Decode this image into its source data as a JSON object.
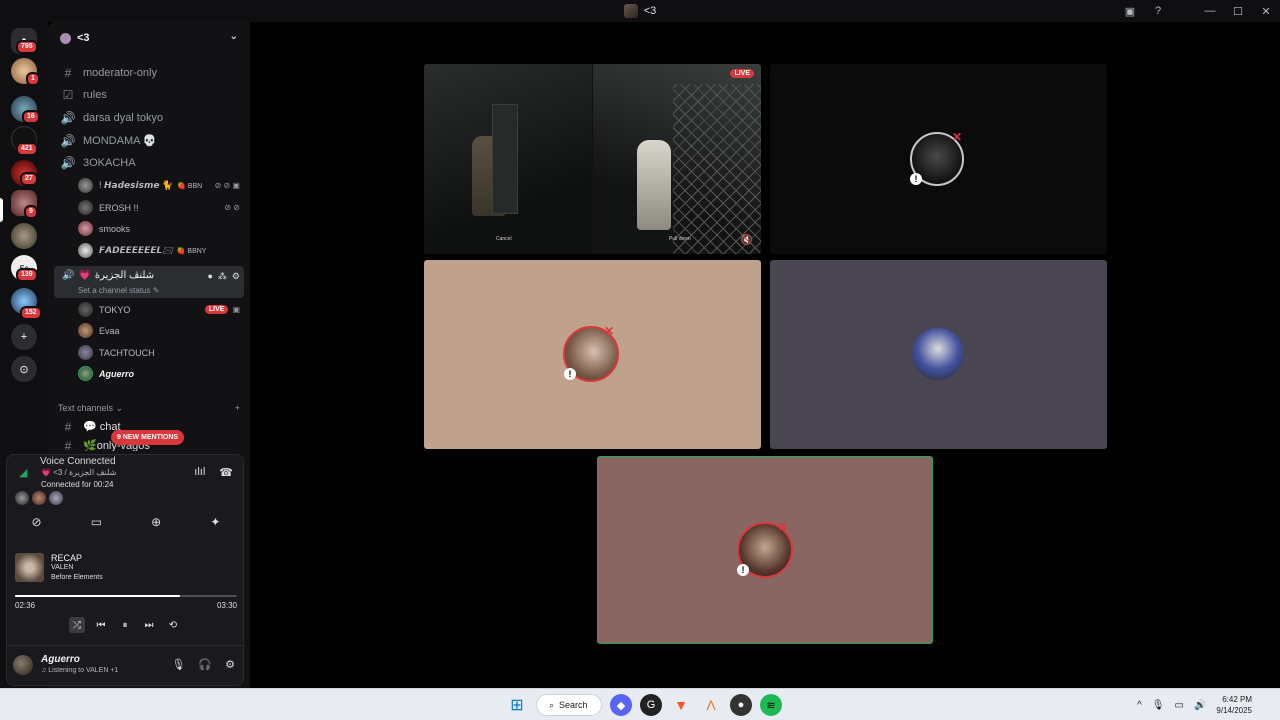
{
  "window": {
    "title": "<3",
    "controls": [
      "—",
      "☐",
      "✕"
    ]
  },
  "rail": {
    "home_badge": "795",
    "servers": [
      {
        "badge": "1"
      },
      {
        "badge": "16"
      },
      {
        "badge": "421"
      },
      {
        "badge": "27"
      },
      {
        "badge": "9"
      },
      {
        "badge": ""
      },
      {
        "badge": "139"
      },
      {
        "badge": "152"
      }
    ]
  },
  "server": {
    "name": "<3"
  },
  "channels": [
    {
      "icon": "#",
      "name": "moderator-only",
      "kind": "text"
    },
    {
      "icon": "☑",
      "name": "rules",
      "kind": "rules"
    },
    {
      "icon": "🔊",
      "name": "darsa dyal tokyo",
      "kind": "voice"
    },
    {
      "icon": "🔊",
      "name": "MONDAMA 💀",
      "kind": "voice"
    },
    {
      "icon": "🔊",
      "name": "3OKACHA",
      "kind": "voice"
    }
  ],
  "okacha_users": [
    {
      "name": "! 𝙃𝙖𝙙𝙚𝙨𝙞𝙨𝙢𝙚 🐈",
      "tag": "🍓 BBN"
    },
    {
      "name": "EROSH !!",
      "tag": ""
    },
    {
      "name": "smooks",
      "tag": ""
    },
    {
      "name": "𝙁𝘼𝘿𝙀𝙀𝙀𝙀𝙀𝙀𝙇🖂",
      "tag": "🍓 BBNY"
    }
  ],
  "active_channel": {
    "name": "شلنڤ الجزيرة",
    "status": "Set a channel status ✎"
  },
  "active_users": [
    {
      "name": "TOKYO",
      "live": "LIVE"
    },
    {
      "name": "Evaa",
      "live": ""
    },
    {
      "name": "TACHTOUCH",
      "live": ""
    },
    {
      "name": "Aguerro",
      "live": ""
    }
  ],
  "text_section": {
    "label": "Text channels ⌄",
    "add": "+"
  },
  "text_channels": [
    {
      "icon": "#",
      "name": "💬 chat"
    },
    {
      "icon": "#",
      "name": "🌿only-vagos"
    }
  ],
  "mentions": "9 NEW MENTIONS",
  "voice": {
    "title": "Voice Connected",
    "channel": "💗 <3 / شلنڤ الجزيرة",
    "duration": "Connected for 00:24"
  },
  "spotify": {
    "track": "RECAP",
    "artist": "VALEN",
    "album": "Before Elements",
    "elapsed": "02:36",
    "total": "03:30",
    "progress": 0.743
  },
  "user": {
    "name": "Aguerro",
    "status": "♫ Listening to VALEN +1"
  },
  "stream": {
    "live": "LIVE",
    "cancel": "Cancel",
    "pulldown": "Pull down"
  },
  "taskbar": {
    "search": "Search",
    "time": "6:42 PM",
    "date": "9/14/2025"
  },
  "colors": {
    "tile_tan": "#c0a18b",
    "tile_slate": "#4a4651",
    "tile_mauve": "#8a6663",
    "tile_dark": "#0b0b0b",
    "speaking": "#23a55a",
    "danger": "#da373c"
  }
}
